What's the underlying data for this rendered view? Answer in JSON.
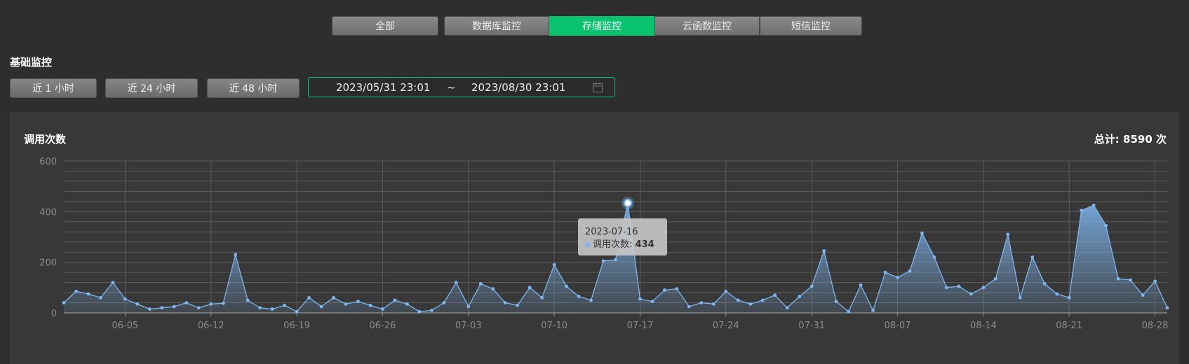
{
  "tabs": [
    {
      "label": "全部",
      "active": false
    },
    {
      "label": "数据库监控",
      "active": false
    },
    {
      "label": "存储监控",
      "active": true
    },
    {
      "label": "云函数监控",
      "active": false
    },
    {
      "label": "短信监控",
      "active": false
    }
  ],
  "section_title": "基础监控",
  "range_buttons": [
    "近 1 小时",
    "近 24 小时",
    "近 48 小时"
  ],
  "date_range": {
    "start": "2023/05/31 23:01",
    "separator": "~",
    "end": "2023/08/30 23:01",
    "icon": "calendar-icon"
  },
  "chart_title": "调用次数",
  "total": "总计: 8590 次",
  "tooltip": {
    "date": "2023-07-16",
    "label": "调用次数:",
    "value": "434"
  },
  "colors": {
    "accent": "#09c36f",
    "line": "#7fb6ef",
    "grid": "#5c5c5c"
  },
  "chart_data": {
    "type": "area",
    "title": "调用次数",
    "series": [
      {
        "name": "调用次数"
      }
    ],
    "x_start": "2023-05-31",
    "x_end": "2023-08-29",
    "x_ticks": [
      "06-05",
      "06-12",
      "06-19",
      "06-26",
      "07-03",
      "07-10",
      "07-17",
      "07-24",
      "07-31",
      "08-07",
      "08-14",
      "08-21",
      "08-28"
    ],
    "y_ticks": [
      0,
      200,
      400,
      600
    ],
    "ylim": [
      0,
      600
    ],
    "values": [
      40,
      85,
      75,
      60,
      120,
      55,
      35,
      15,
      20,
      25,
      40,
      20,
      35,
      38,
      230,
      50,
      20,
      15,
      30,
      5,
      60,
      25,
      60,
      35,
      45,
      30,
      15,
      50,
      35,
      5,
      10,
      40,
      120,
      25,
      115,
      95,
      40,
      30,
      100,
      60,
      190,
      105,
      65,
      50,
      205,
      210,
      434,
      55,
      45,
      90,
      95,
      25,
      40,
      35,
      85,
      50,
      35,
      50,
      70,
      20,
      65,
      105,
      245,
      45,
      5,
      110,
      10,
      160,
      140,
      165,
      315,
      220,
      100,
      105,
      75,
      100,
      135,
      310,
      60,
      220,
      115,
      75,
      60,
      405,
      425,
      345,
      135,
      130,
      70,
      125,
      20
    ],
    "highlight": {
      "x": "2023-07-16",
      "y": 434
    },
    "grid": true
  }
}
